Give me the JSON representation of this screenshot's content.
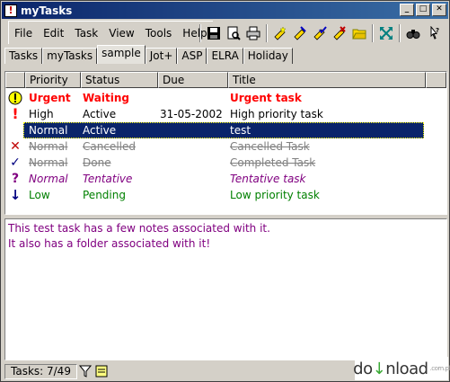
{
  "window": {
    "title": "myTasks"
  },
  "menu": [
    "File",
    "Edit",
    "Task",
    "View",
    "Tools",
    "Help"
  ],
  "toolbar_icons": [
    "save-icon",
    "print-preview-icon",
    "print-icon",
    "new-task-icon",
    "edit-task-icon",
    "complete-task-icon",
    "cancel-task-icon",
    "folder-icon",
    "expand-icon",
    "find-icon",
    "help-icon"
  ],
  "tabs": [
    {
      "label": "Tasks"
    },
    {
      "label": "myTasks"
    },
    {
      "label": "sample",
      "active": true
    },
    {
      "label": "Jot+"
    },
    {
      "label": "ASP"
    },
    {
      "label": "ELRA"
    },
    {
      "label": "Holiday"
    }
  ],
  "columns": {
    "priority": "Priority",
    "status": "Status",
    "due": "Due",
    "title": "Title"
  },
  "tasks": [
    {
      "icon": "!",
      "icon_name": "urgent-icon",
      "priority": "Urgent",
      "status": "Waiting",
      "due": "",
      "title": "Urgent task",
      "color": "#ff0000",
      "style": "bold"
    },
    {
      "icon": "!",
      "icon_name": "high-priority-icon",
      "priority": "High",
      "status": "Active",
      "due": "31-05-2002",
      "title": "High priority task",
      "color": "#000000",
      "style": "normal"
    },
    {
      "icon": "",
      "icon_name": "",
      "priority": "Normal",
      "status": "Active",
      "due": "",
      "title": "test",
      "color": "#ffffff",
      "style": "selected"
    },
    {
      "icon": "✕",
      "icon_name": "cancelled-icon",
      "priority": "Normal",
      "status": "Cancelled",
      "due": "",
      "title": "Cancelled Task",
      "color": "#808080",
      "style": "strike"
    },
    {
      "icon": "✓",
      "icon_name": "done-icon",
      "priority": "Normal",
      "status": "Done",
      "due": "",
      "title": "Completed Task",
      "color": "#808080",
      "style": "strike"
    },
    {
      "icon": "?",
      "icon_name": "tentative-icon",
      "priority": "Normal",
      "status": "Tentative",
      "due": "",
      "title": "Tentative task",
      "color": "#800080",
      "style": "italic"
    },
    {
      "icon": "↓",
      "icon_name": "low-priority-icon",
      "priority": "Low",
      "status": "Pending",
      "due": "",
      "title": "Low priority task",
      "color": "#008000",
      "style": "normal"
    }
  ],
  "notes": [
    "This test task has a few notes associated with it.",
    "It also has a folder associated with it!"
  ],
  "status": {
    "count": "Tasks: 7/49"
  },
  "watermark": {
    "text_a": "do",
    "text_b": "nload",
    "suffix": ".com.pl"
  }
}
